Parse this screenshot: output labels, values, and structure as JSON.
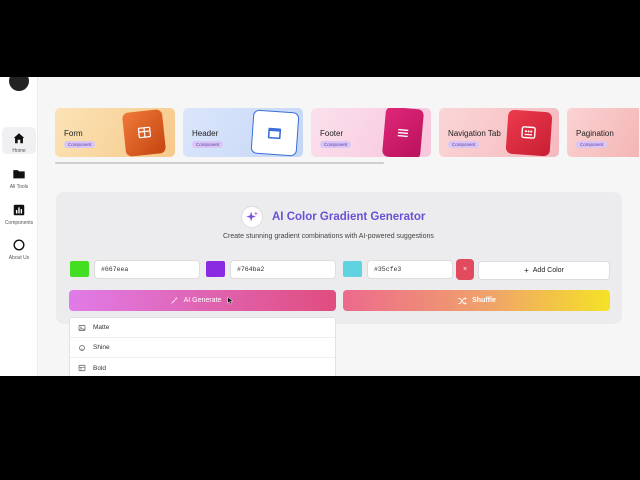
{
  "sidebar": {
    "items": [
      {
        "label": "Home",
        "icon": "home-icon"
      },
      {
        "label": "All Tools",
        "icon": "folder-icon"
      },
      {
        "label": "Components",
        "icon": "chart-icon"
      },
      {
        "label": "About Us",
        "icon": "circle-icon"
      }
    ]
  },
  "cards": [
    {
      "title": "Form",
      "badge": "Component"
    },
    {
      "title": "Header",
      "badge": "Component"
    },
    {
      "title": "Footer",
      "badge": "Component"
    },
    {
      "title": "Navigation Tab",
      "badge": "Component"
    },
    {
      "title": "Pagination",
      "badge": "Component"
    }
  ],
  "generator": {
    "title": "AI Color Gradient Generator",
    "subtitle": "Create stunning gradient combinations with AI-powered suggestions",
    "colors": [
      {
        "hex": "#667eea",
        "swatch": "#44dd22"
      },
      {
        "hex": "#764ba2",
        "swatch": "#8a2be2"
      },
      {
        "hex": "#35cfe3",
        "swatch": "#5fd3df"
      }
    ],
    "delete_label": "×",
    "add_label": "Add Color",
    "ai_generate_label": "AI Generate",
    "shuffle_label": "Shuffle"
  },
  "dropdown": {
    "options": [
      {
        "label": "Matte",
        "icon": "image-icon"
      },
      {
        "label": "Shine",
        "icon": "sun-icon"
      },
      {
        "label": "Bold",
        "icon": "grid-icon"
      }
    ]
  }
}
